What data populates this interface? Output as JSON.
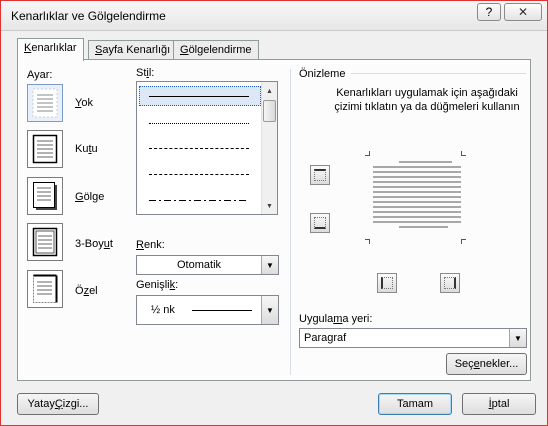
{
  "window": {
    "title": "Kenarlıklar ve Gölgelendirme",
    "help_label": "?",
    "close_label": "✕"
  },
  "tabs": [
    {
      "pre": "",
      "key": "K",
      "post": "enarlıklar"
    },
    {
      "pre": "",
      "key": "S",
      "post": "ayfa Kenarlığı"
    },
    {
      "pre": "",
      "key": "G",
      "post": "ölgelendirme"
    }
  ],
  "setting": {
    "label": "Ayar:",
    "items": [
      {
        "pre": "",
        "key": "Y",
        "post": "ok",
        "icon": "setting-none-icon"
      },
      {
        "pre": "Ku",
        "key": "t",
        "post": "u",
        "icon": "setting-box-icon"
      },
      {
        "pre": "",
        "key": "G",
        "post": "ölge",
        "icon": "setting-shadow-icon"
      },
      {
        "pre": "3-Boy",
        "key": "u",
        "post": "t",
        "icon": "setting-3d-icon"
      },
      {
        "pre": "Ö",
        "key": "z",
        "post": "el",
        "icon": "setting-custom-icon"
      }
    ]
  },
  "style": {
    "label_pre": "St",
    "label_key": "i",
    "label_post": "l:"
  },
  "color": {
    "label_pre": "",
    "label_key": "R",
    "label_post": "enk:",
    "value": "Otomatik"
  },
  "width": {
    "label_pre": "Genişli",
    "label_key": "k",
    "label_post": ":",
    "value": "½ nk"
  },
  "preview": {
    "label": "Önizleme",
    "instructions": "Kenarlıkları uygulamak için aşağıdaki çizimi tıklatın ya da düğmeleri kullanın"
  },
  "apply_to": {
    "label_pre": "Uygula",
    "label_key": "m",
    "label_post": "a yeri:",
    "value": "Paragraf"
  },
  "buttons": {
    "options": {
      "pre": "Seç",
      "key": "e",
      "post": "nekler..."
    },
    "horizontal_line": {
      "pre": "Yatay ",
      "key": "Ç",
      "post": "izgi..."
    },
    "ok": "Tamam",
    "cancel": {
      "pre": "",
      "key": "İ",
      "post": "ptal"
    }
  }
}
